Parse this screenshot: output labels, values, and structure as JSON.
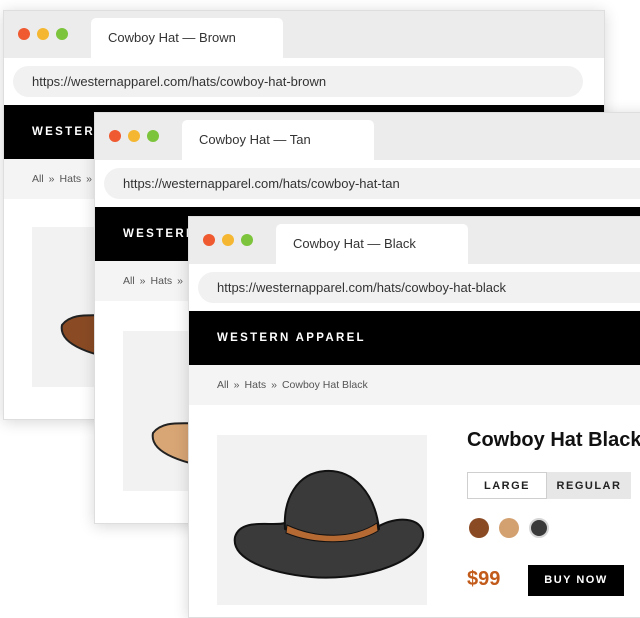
{
  "windows": [
    {
      "tab_title": "Cowboy Hat — Brown",
      "url": "https://westernapparel.com/hats/cowboy-hat-brown",
      "brand": "WESTERN",
      "breadcrumb": [
        "All",
        "Hats"
      ],
      "breadcrumb_sep": "»",
      "hat_color": "#8a4b24",
      "hat_shade": "#5a2d13",
      "hat_band": "#6b3a1c"
    },
    {
      "tab_title": "Cowboy Hat — Tan",
      "url": "https://westernapparel.com/hats/cowboy-hat-tan",
      "brand": "WESTERN",
      "breadcrumb": [
        "All",
        "Hats"
      ],
      "breadcrumb_sep": "»",
      "hat_color": "#d8a675",
      "hat_shade": "#9a6b3e",
      "hat_band": "#b07a47"
    },
    {
      "tab_title": "Cowboy Hat — Black",
      "url": "https://westernapparel.com/hats/cowboy-hat-black",
      "brand": "WESTERN APPAREL",
      "breadcrumb": [
        "All",
        "Hats",
        "Cowboy Hat Black"
      ],
      "breadcrumb_sep": "»",
      "hat_color": "#3a3a3a",
      "hat_shade": "#1c1c1c",
      "hat_band": "#b56a34",
      "product": {
        "title": "Cowboy Hat Black",
        "sizes": [
          "LARGE",
          "REGULAR"
        ],
        "selected_size": "REGULAR",
        "swatches": [
          "#8a4b24",
          "#d3a070",
          "#3a3a3a"
        ],
        "price": "$99",
        "buy_label": "BUY NOW"
      }
    }
  ],
  "traffic_lights": [
    "#ef5a30",
    "#f5b731",
    "#7cc43b"
  ],
  "icons": {
    "window_controls": "traffic-light-dots",
    "product_image": "cowboy-hat-icon"
  }
}
